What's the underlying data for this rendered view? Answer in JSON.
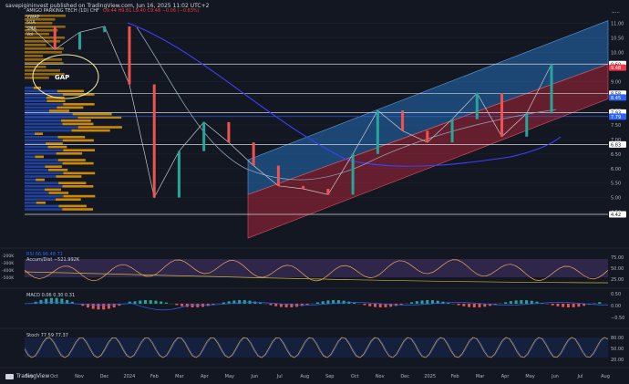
{
  "header": {
    "text": "savepigininvest published on TradingView.com, Jun 16, 2025 11:02 UTC+2"
  },
  "legend": {
    "title": "AMIGO PARKING TECH (1D) CHF",
    "ohlc": "O9.44  H9.81  L9.40  C9.48  −0.06 (−0.63%)",
    "lines": [
      "VWAP",
      "50A",
      "SMA",
      "Vol"
    ]
  },
  "currency": "CHF",
  "gap_label": "GAP",
  "price_axis": {
    "ticks": [
      11.0,
      10.5,
      10.0,
      9.5,
      9.0,
      8.5,
      8.0,
      7.5,
      7.0,
      6.5,
      6.0,
      5.5,
      5.0,
      4.5
    ],
    "tags": [
      {
        "label": "9.60",
        "value": 9.6,
        "color": "#ffffff",
        "text": "#131722"
      },
      {
        "label": "9.48",
        "value": 9.48,
        "color": "#f23645",
        "text": "#ffffff"
      },
      {
        "label": "8.58",
        "value": 8.58,
        "color": "#ffffff",
        "text": "#131722"
      },
      {
        "label": "8.45",
        "value": 8.45,
        "color": "#2962ff",
        "text": "#ffffff"
      },
      {
        "label": "7.93",
        "value": 7.93,
        "color": "#ffffff",
        "text": "#131722"
      },
      {
        "label": "7.79",
        "value": 7.79,
        "color": "#2962ff",
        "text": "#ffffff"
      },
      {
        "label": "6.83",
        "value": 6.83,
        "color": "#ffffff",
        "text": "#131722"
      },
      {
        "label": "4.42",
        "value": 4.42,
        "color": "#ffffff",
        "text": "#131722"
      }
    ],
    "min": 4.2,
    "max": 11.4
  },
  "horizontal_levels": [
    9.6,
    8.58,
    7.93,
    7.79,
    6.83,
    4.42
  ],
  "time_axis": [
    "Sep",
    "Oct",
    "Nov",
    "Dec",
    "2024",
    "Feb",
    "Mar",
    "Apr",
    "May",
    "Jun",
    "Jul",
    "Aug",
    "Sep",
    "Oct",
    "Nov",
    "Dec",
    "2025",
    "Feb",
    "Mar",
    "Apr",
    "May",
    "Jun",
    "Jul",
    "Aug"
  ],
  "chart_data": {
    "type": "line",
    "title": "AMIGO PARKING TECH (1D) CHF",
    "xlabel": "",
    "ylabel": "",
    "x": [
      "Sep",
      "Oct",
      "Nov",
      "Dec",
      "2024",
      "Feb",
      "Mar",
      "Apr",
      "May",
      "Jun",
      "Jul",
      "Aug",
      "Sep",
      "Oct",
      "Nov",
      "Dec",
      "2025",
      "Feb",
      "Mar",
      "Apr",
      "May",
      "Jun"
    ],
    "series": [
      {
        "name": "",
        "values": [
          10.9,
          10.1,
          10.7,
          10.9,
          8.9,
          5.0,
          6.6,
          7.6,
          6.9,
          6.1,
          5.4,
          5.3,
          5.1,
          6.5,
          8.0,
          7.3,
          6.9,
          7.7,
          8.6,
          7.1,
          7.9,
          9.6
        ]
      }
    ],
    "ylim": [
      4.2,
      11.4
    ],
    "channel": {
      "upper_start": 6.3,
      "upper_end": 11.1,
      "mid_start": 5.1,
      "mid_end": 9.6,
      "lower_start": 3.6,
      "lower_end": 8.4
    }
  },
  "rsi": {
    "label": "RSI  66.96  48  71",
    "label2": "Accum/Dist  −521.992K",
    "ticks_left": [
      "-200K",
      "-300K",
      "-400K",
      "-500K"
    ],
    "ticks_right": [
      "75.00",
      "50.00",
      "25.00"
    ]
  },
  "macd": {
    "label": "MACD  0.06  0.30  0.31",
    "ticks_right": [
      "0.50",
      "0.00",
      "−0.50"
    ]
  },
  "stoch": {
    "label": "Stoch  77.59  77.37",
    "ticks_right": [
      "80.00",
      "50.00",
      "20.00"
    ]
  },
  "footer": {
    "logo": "TradingView"
  }
}
